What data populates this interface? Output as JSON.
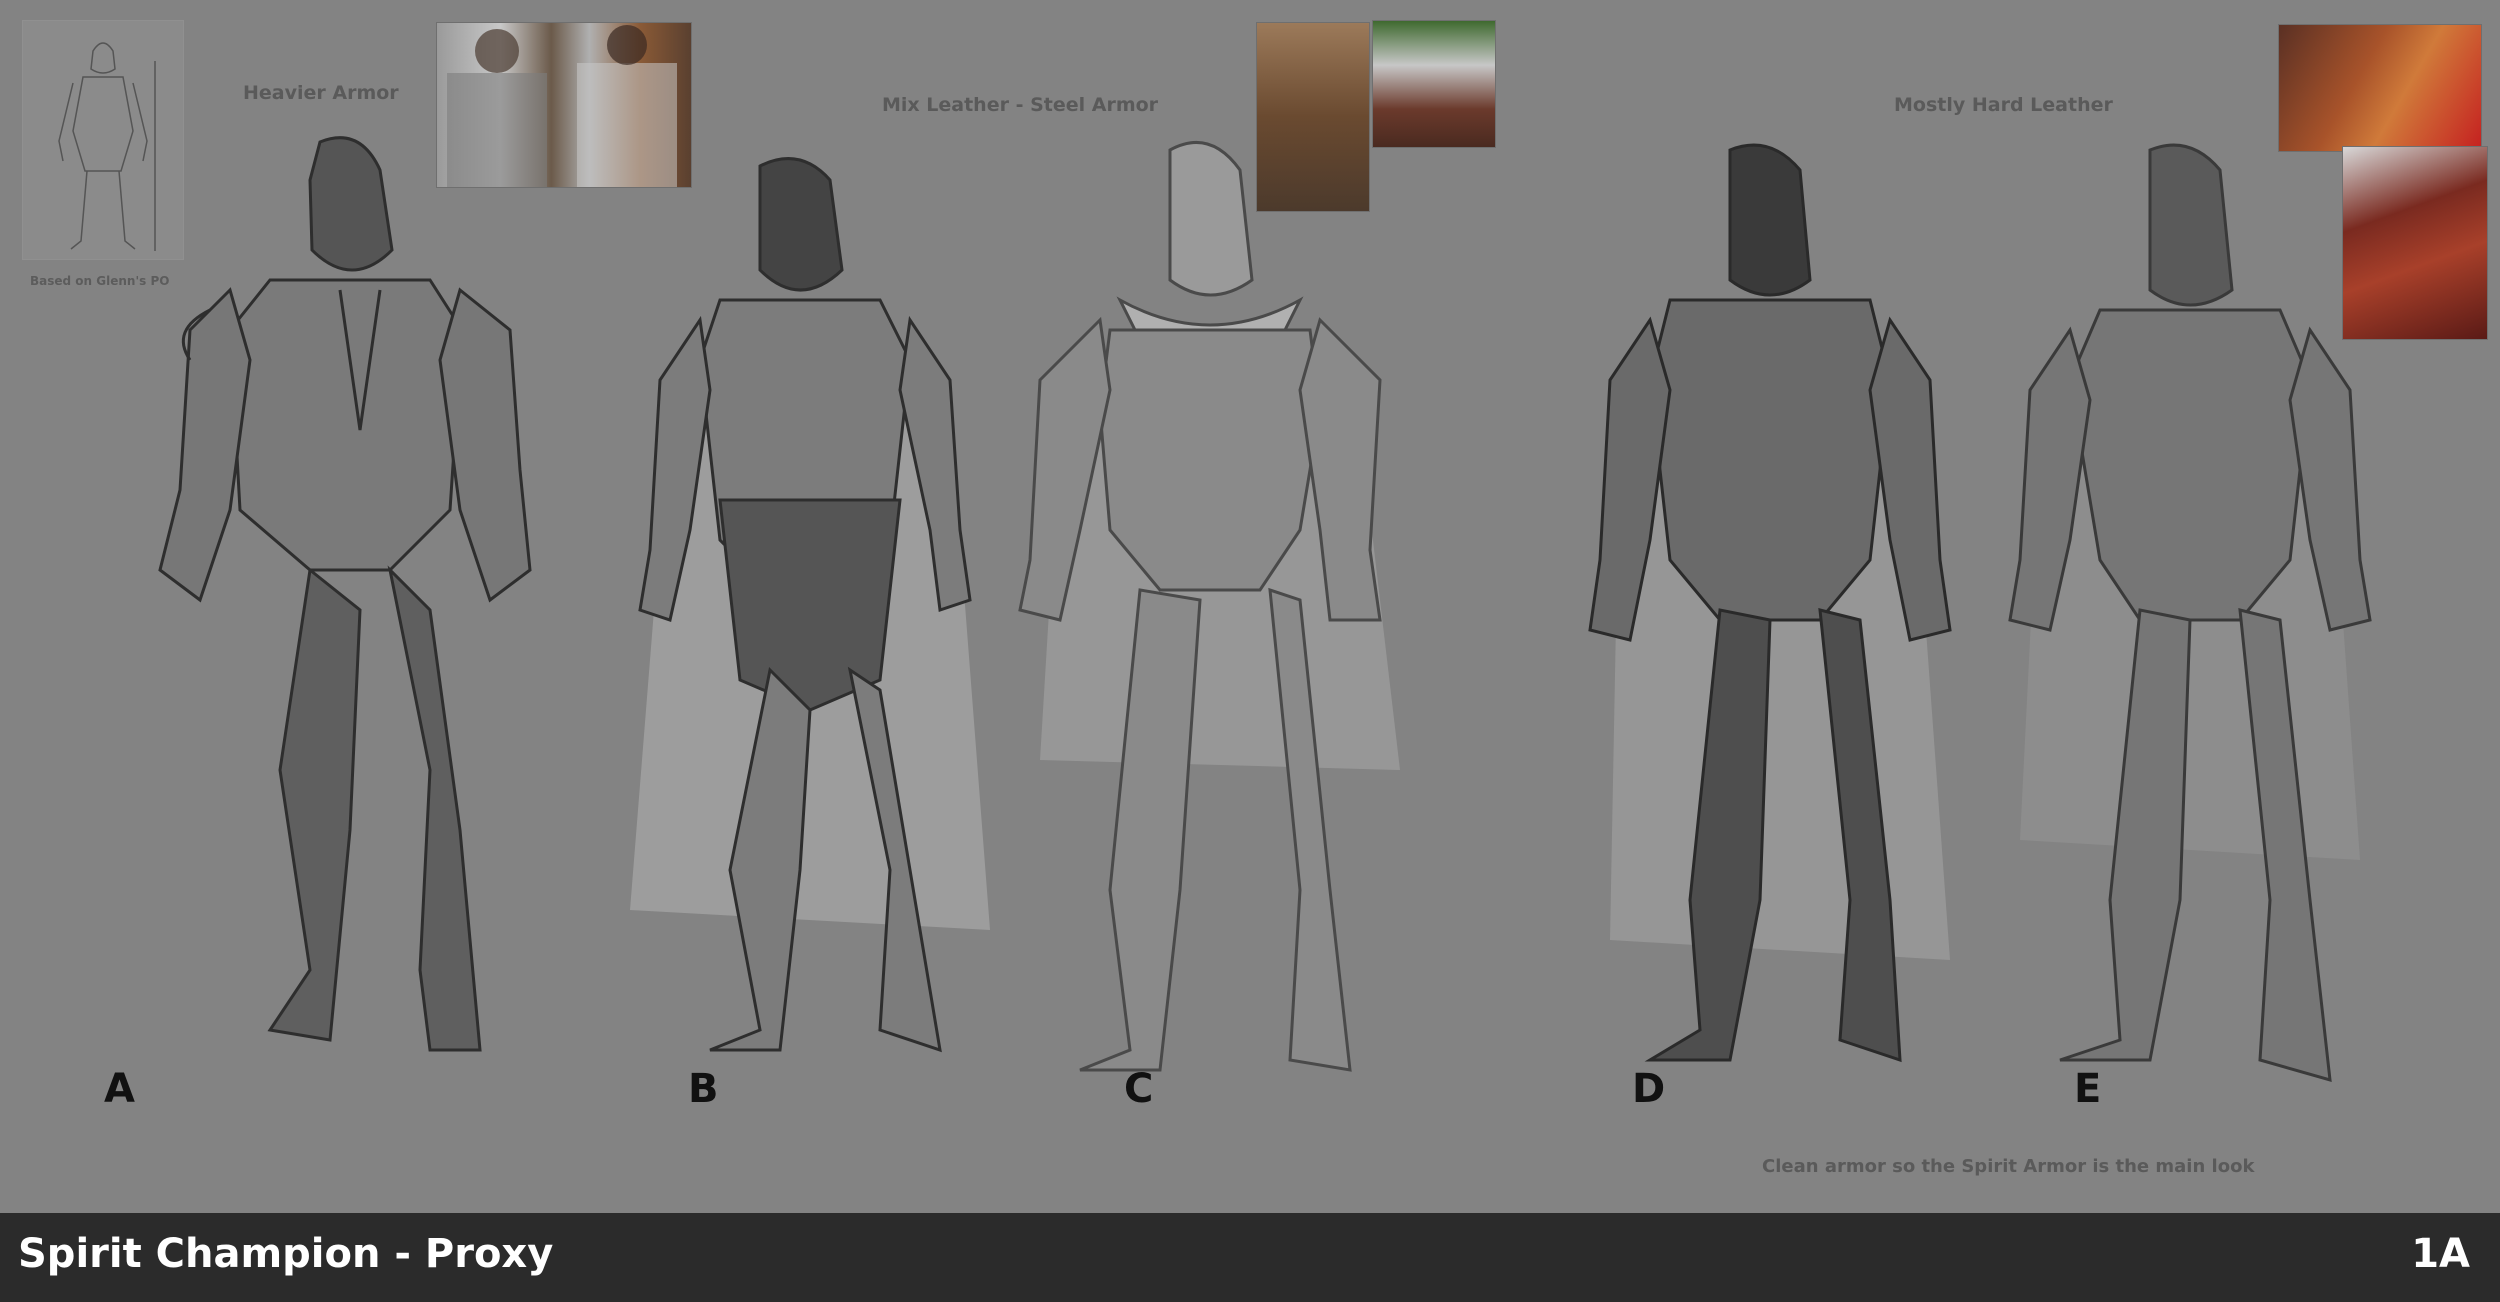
{
  "sections": {
    "heavier": "Heavier Armor",
    "mix": "Mix Leather - Steel Armor",
    "leather": "Mostly Hard Leather"
  },
  "thumbnail_caption": "Based on Glenn's PO",
  "variants": [
    "A",
    "B",
    "C",
    "D",
    "E"
  ],
  "note": "Clean armor so the Spirit Armor is the main look",
  "footer": {
    "title": "Spirit Champion - Proxy",
    "code": "1A"
  },
  "colors": {
    "background": "#838383",
    "footer_bar": "#2b2b2b",
    "footer_text": "#ffffff",
    "label_text": "#5a5a5a"
  }
}
